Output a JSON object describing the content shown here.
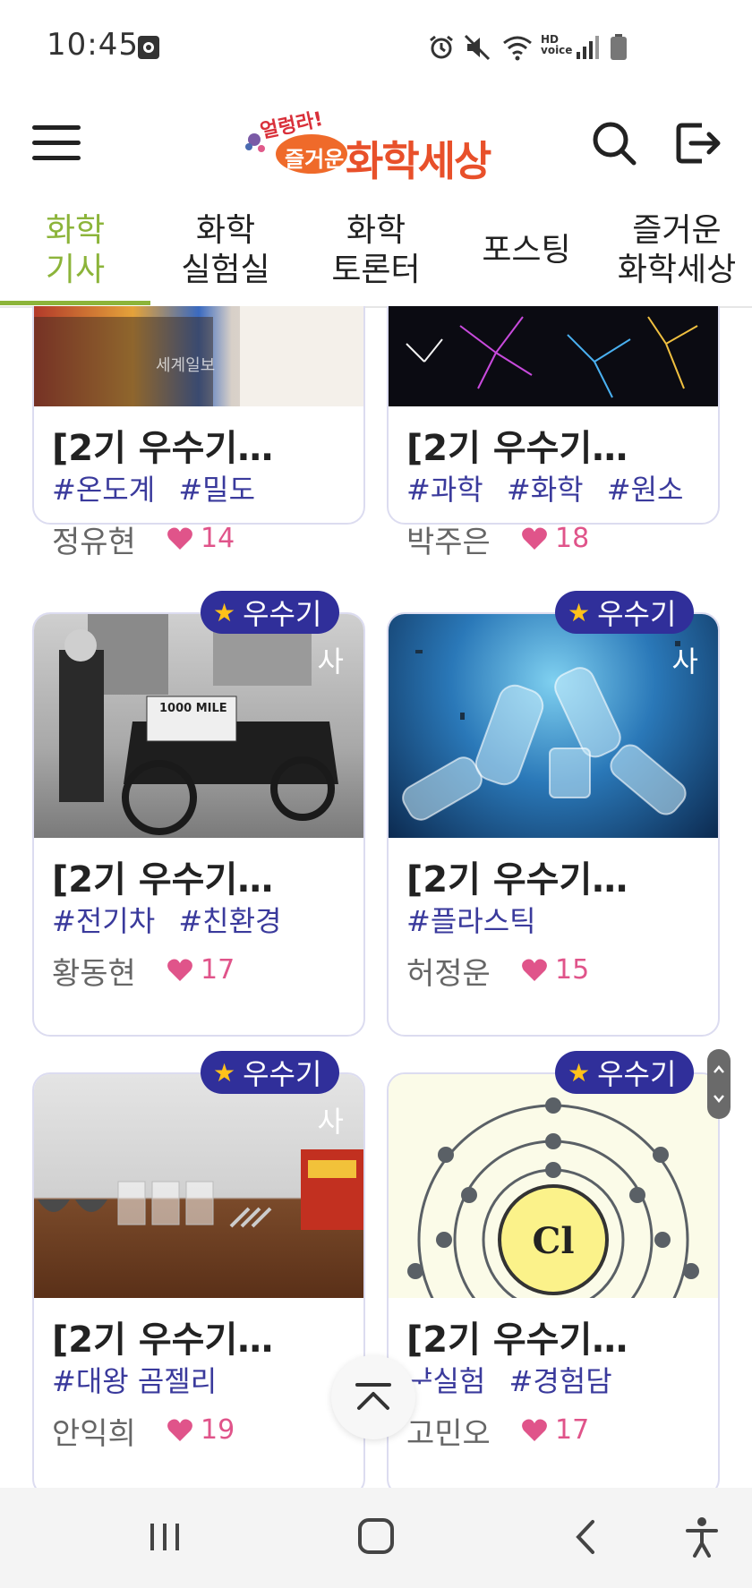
{
  "status_bar": {
    "time": "10:45",
    "icons": [
      "screenshot-icon",
      "alarm-icon",
      "mute-icon",
      "wifi-icon",
      "hd-voice-icon",
      "signal-icon",
      "battery-icon"
    ],
    "hd_voice": "HD voice"
  },
  "header": {
    "logo_small": "얼렁라!",
    "logo_fun": "즐거운",
    "logo_main": "화학세상",
    "menu_icon": "hamburger-icon",
    "search_icon": "search-icon",
    "logout_icon": "logout-icon"
  },
  "tabs": [
    {
      "label": "화학\n기사",
      "active": true
    },
    {
      "label": "화학\n실험실",
      "active": false
    },
    {
      "label": "화학\n토론터",
      "active": false
    },
    {
      "label": "포스팅",
      "active": false
    },
    {
      "label": "즐거운\n화학세상",
      "active": false
    }
  ],
  "cards": [
    {
      "title": "[2기 우수기…",
      "tags": [
        "#온도계",
        "#밀도"
      ],
      "author": "정유현",
      "likes": "14",
      "badge": null,
      "watermark": "세계일보"
    },
    {
      "title": "[2기 우수기…",
      "tags": [
        "#과학",
        "#화학",
        "#원소"
      ],
      "author": "박주은",
      "likes": "18",
      "badge": null
    },
    {
      "title": "[2기 우수기…",
      "tags": [
        "#전기차",
        "#친환경"
      ],
      "author": "황동현",
      "likes": "17",
      "badge": "우수기",
      "badge_tail": "사",
      "photo_sign": "1000 MILE"
    },
    {
      "title": "[2기 우수기…",
      "tags": [
        "#플라스틱"
      ],
      "author": "허정운",
      "likes": "15",
      "badge": "우수기",
      "badge_tail": "사"
    },
    {
      "title": "[2기 우수기…",
      "tags": [
        "#대왕 곰젤리"
      ],
      "author": "안익희",
      "likes": "19",
      "badge": "우수기",
      "badge_tail": "사"
    },
    {
      "title": "[2기 우수기…",
      "tags": [
        "ᅷ실험",
        "#경험담"
      ],
      "author": "고민오",
      "likes": "17",
      "badge": "우수기",
      "badge_tail": "",
      "element_symbol": "Cl"
    }
  ],
  "colors": {
    "accent_green": "#8cb43a",
    "badge_navy": "#302f9a",
    "tag_blue": "#3a3a9c",
    "heart_pink": "#e0548a"
  },
  "nav_bar": {
    "icons": [
      "recent-apps-icon",
      "home-icon",
      "back-icon",
      "accessibility-icon"
    ]
  }
}
